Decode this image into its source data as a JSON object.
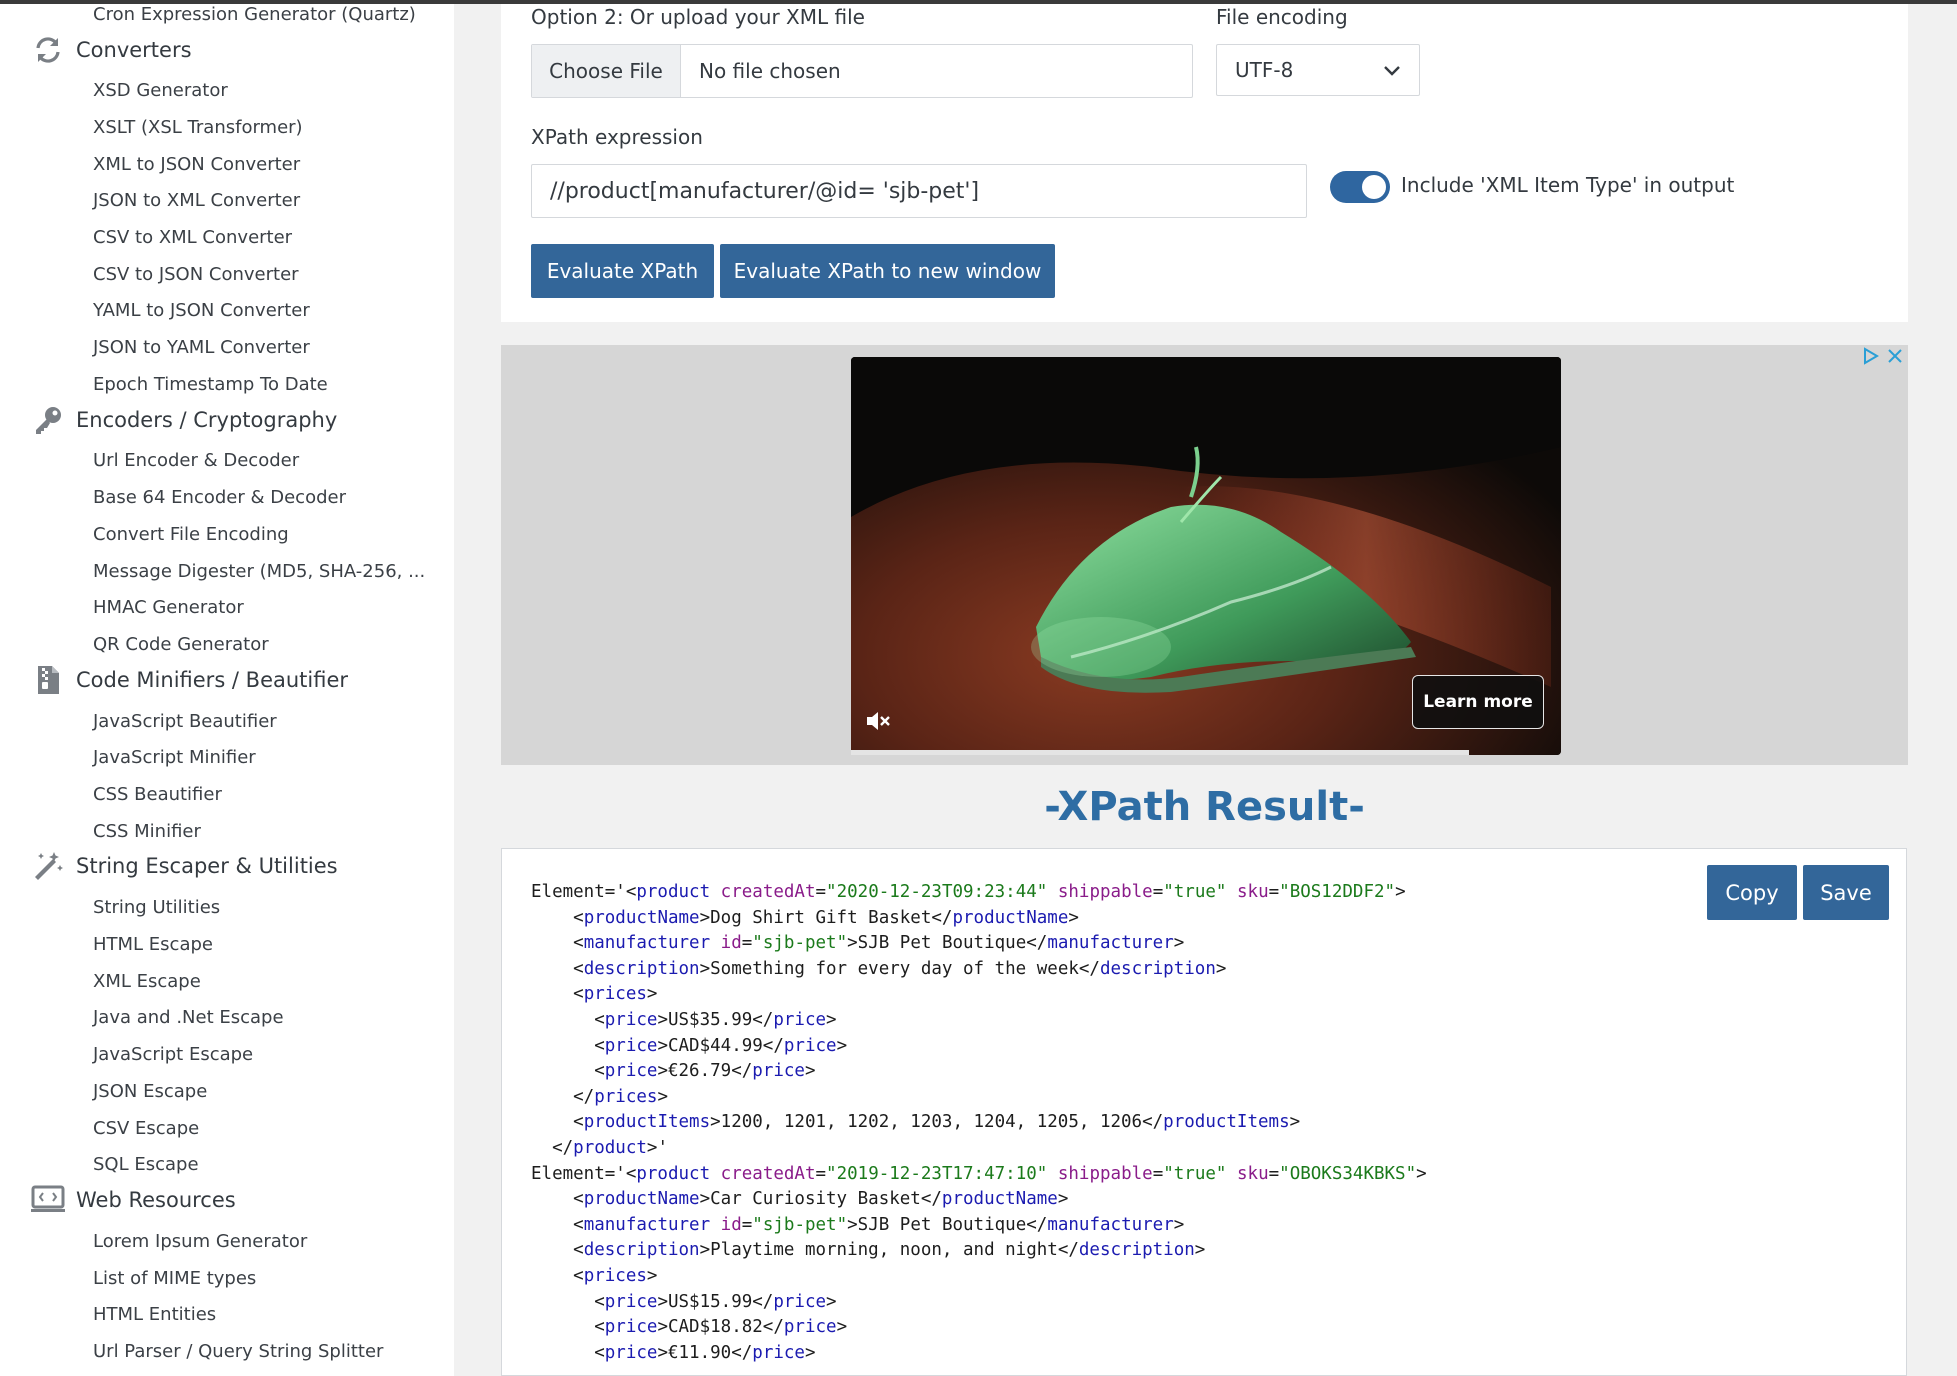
{
  "sidebar": {
    "top_item": "Cron Expression Generator (Quartz)",
    "categories": [
      {
        "label": "Converters",
        "icon": "refresh-icon"
      },
      {
        "label": "Encoders / Cryptography",
        "icon": "key-icon"
      },
      {
        "label": "Code Minifiers / Beautifier",
        "icon": "zip-file-icon"
      },
      {
        "label": "String Escaper & Utilities",
        "icon": "magic-wand-icon"
      },
      {
        "label": "Web Resources",
        "icon": "monitor-icon"
      }
    ],
    "converters": [
      "XSD Generator",
      "XSLT (XSL Transformer)",
      "XML to JSON Converter",
      "JSON to XML Converter",
      "CSV to XML Converter",
      "CSV to JSON Converter",
      "YAML to JSON Converter",
      "JSON to YAML Converter",
      "Epoch Timestamp To Date"
    ],
    "encoders": [
      "Url Encoder & Decoder",
      "Base 64 Encoder & Decoder",
      "Convert File Encoding",
      "Message Digester (MD5, SHA-256, ...",
      "HMAC Generator",
      "QR Code Generator"
    ],
    "minifiers": [
      "JavaScript Beautifier",
      "JavaScript Minifier",
      "CSS Beautifier",
      "CSS Minifier"
    ],
    "escapers": [
      "String Utilities",
      "HTML Escape",
      "XML Escape",
      "Java and .Net Escape",
      "JavaScript Escape",
      "JSON Escape",
      "CSV Escape",
      "SQL Escape"
    ],
    "web": [
      "Lorem Ipsum Generator",
      "List of MIME types",
      "HTML Entities",
      "Url Parser / Query String Splitter"
    ]
  },
  "form": {
    "upload_label": "Option 2: Or upload your XML file",
    "choose_file": "Choose File",
    "no_file": "No file chosen",
    "encoding_label": "File encoding",
    "encoding_value": "UTF-8",
    "xpath_label": "XPath expression",
    "xpath_value": "//product[manufacturer/@id= 'sjb-pet']",
    "toggle_label": "Include 'XML Item Type' in output",
    "toggle_on": true,
    "evaluate": "Evaluate XPath",
    "evaluate_new": "Evaluate XPath to new window"
  },
  "ad": {
    "learn_more": "Learn more",
    "progress": 0.87
  },
  "result": {
    "title": "-XPath Result-",
    "copy": "Copy",
    "save": "Save",
    "lines": [
      "Element='<product createdAt=\"2020-12-23T09:23:44\" shippable=\"true\" sku=\"BOS12DDF2\">",
      "    <productName>Dog Shirt Gift Basket</productName>",
      "    <manufacturer id=\"sjb-pet\">SJB Pet Boutique</manufacturer>",
      "    <description>Something for every day of the week</description>",
      "    <prices>",
      "      <price>US$35.99</price>",
      "      <price>CAD$44.99</price>",
      "      <price>€26.79</price>",
      "    </prices>",
      "    <productItems>1200, 1201, 1202, 1203, 1204, 1205, 1206</productItems>",
      "  </product>'",
      "Element='<product createdAt=\"2019-12-23T17:47:10\" shippable=\"true\" sku=\"OBOKS34KBKS\">",
      "    <productName>Car Curiosity Basket</productName>",
      "    <manufacturer id=\"sjb-pet\">SJB Pet Boutique</manufacturer>",
      "    <description>Playtime morning, noon, and night</description>",
      "    <prices>",
      "      <price>US$15.99</price>",
      "      <price>CAD$18.82</price>",
      "      <price>€11.90</price>"
    ]
  },
  "colors": {
    "accent": "#336699",
    "title": "#2e6da4",
    "xml_tag": "#1b1bb0",
    "xml_attr": "#8a1c8a",
    "xml_value": "#1b7a1b"
  }
}
